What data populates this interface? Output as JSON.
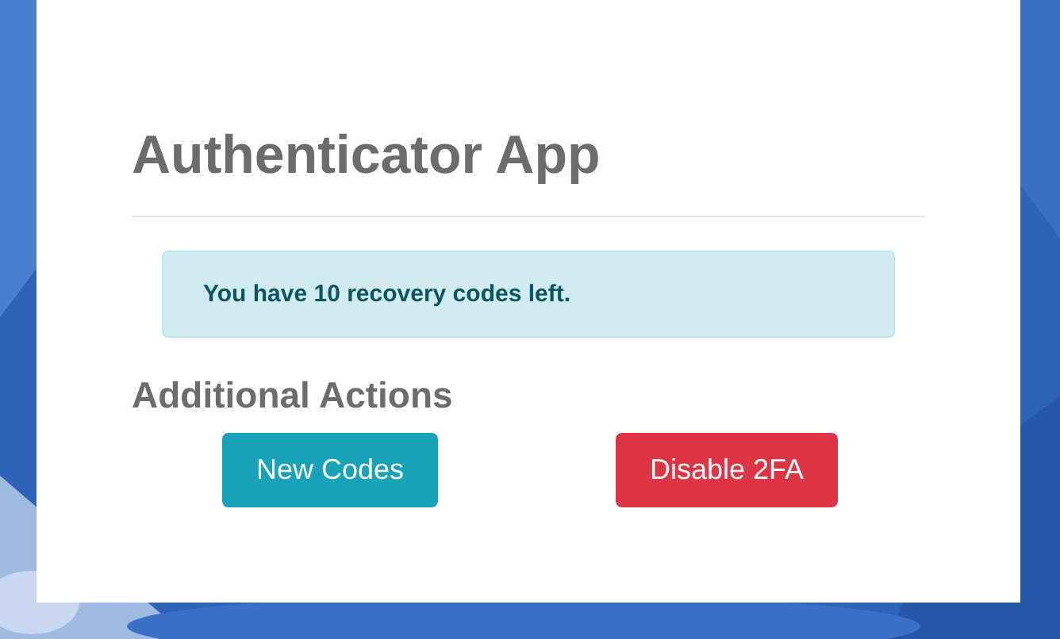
{
  "title": "Authenticator App",
  "alert": {
    "kind": "info",
    "text": "You have 10 recovery codes left."
  },
  "section_title": "Additional Actions",
  "buttons": [
    {
      "label": "New Codes",
      "kind": "info"
    },
    {
      "label": "Disable 2FA",
      "kind": "danger"
    }
  ]
}
